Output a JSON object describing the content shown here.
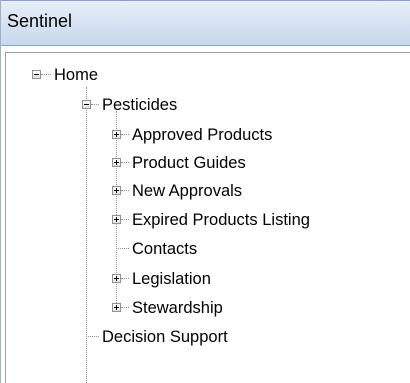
{
  "panel": {
    "title": "Sentinel"
  },
  "tree": {
    "home": {
      "label": "Home",
      "expanded": true
    },
    "pesticides": {
      "label": "Pesticides",
      "expanded": true
    },
    "pesticide_children": [
      {
        "label": "Approved Products",
        "has_children": true
      },
      {
        "label": "Product Guides",
        "has_children": true
      },
      {
        "label": "New Approvals",
        "has_children": true
      },
      {
        "label": "Expired Products Listing",
        "has_children": true
      },
      {
        "label": "Contacts",
        "has_children": false
      },
      {
        "label": "Legislation",
        "has_children": true
      },
      {
        "label": "Stewardship",
        "has_children": true
      }
    ],
    "decision_support": {
      "label": "Decision Support",
      "has_children": false
    }
  }
}
